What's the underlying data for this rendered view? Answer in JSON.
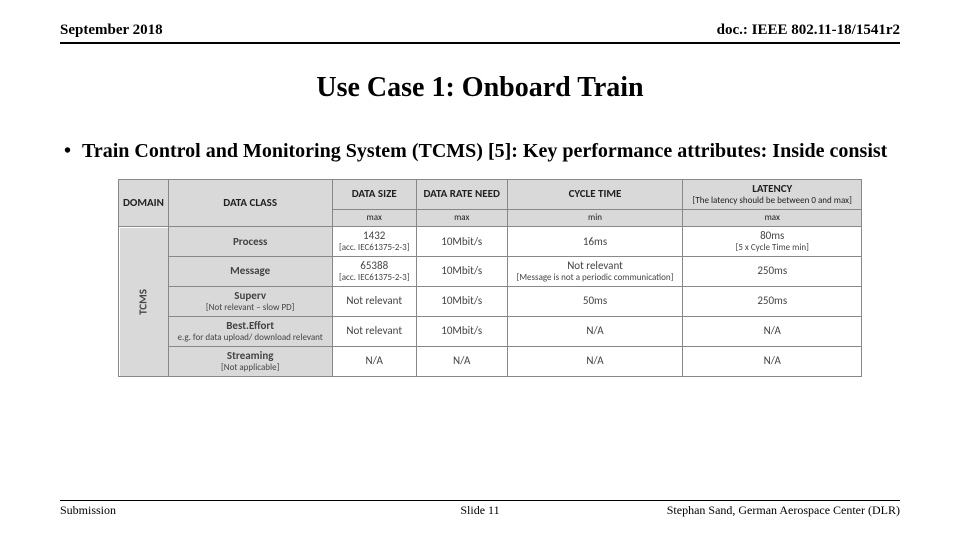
{
  "header": {
    "date": "September 2018",
    "docnum": "doc.: IEEE 802.11-18/1541r2"
  },
  "title": "Use Case 1: Onboard Train",
  "bullet": "Train Control and Monitoring System (TCMS) [5]: Key performance attributes: Inside consist",
  "table": {
    "head": {
      "domain": "DOMAIN",
      "dataclass": "DATA CLASS",
      "datasize": "DATA SIZE",
      "datarate": "DATA RATE NEED",
      "cycletime": "CYCLE TIME",
      "latency": "LATENCY",
      "latency_note": "[The latency should be between 0 and max]",
      "sub_max1": "max",
      "sub_max2": "max",
      "sub_min": "min",
      "sub_max3": "max"
    },
    "domain_label": "TCMS",
    "rows": [
      {
        "class": "Process",
        "class_note": "",
        "size": "1432",
        "size_note": "[acc. IEC61375-2-3]",
        "rate": "10Mbit/s",
        "cycle": "16ms",
        "lat": "80ms",
        "lat_note": "[5 x Cycle Time min]"
      },
      {
        "class": "Message",
        "class_note": "",
        "size": "65388",
        "size_note": "[acc. IEC61375-2-3]",
        "rate": "10Mbit/s",
        "cycle": "Not relevant",
        "cycle_note": "[Message is not a periodic communication]",
        "lat": "250ms",
        "lat_note": ""
      },
      {
        "class": "Superv",
        "class_note": "[Not relevant – slow PD]",
        "size": "Not relevant",
        "size_note": "",
        "rate": "10Mbit/s",
        "cycle": "50ms",
        "lat": "250ms",
        "lat_note": ""
      },
      {
        "class": "Best.Effort",
        "class_note": "e.g. for data upload/ download relevant",
        "size": "Not relevant",
        "size_note": "",
        "rate": "10Mbit/s",
        "cycle": "N/A",
        "lat": "N/A",
        "lat_note": ""
      },
      {
        "class": "Streaming",
        "class_note": "[Not applicable]",
        "size": "N/A",
        "size_note": "",
        "rate": "N/A",
        "cycle": "N/A",
        "lat": "N/A",
        "lat_note": ""
      }
    ]
  },
  "footer": {
    "left": "Submission",
    "mid": "Slide 11",
    "right": "Stephan Sand, German Aerospace Center (DLR)"
  }
}
